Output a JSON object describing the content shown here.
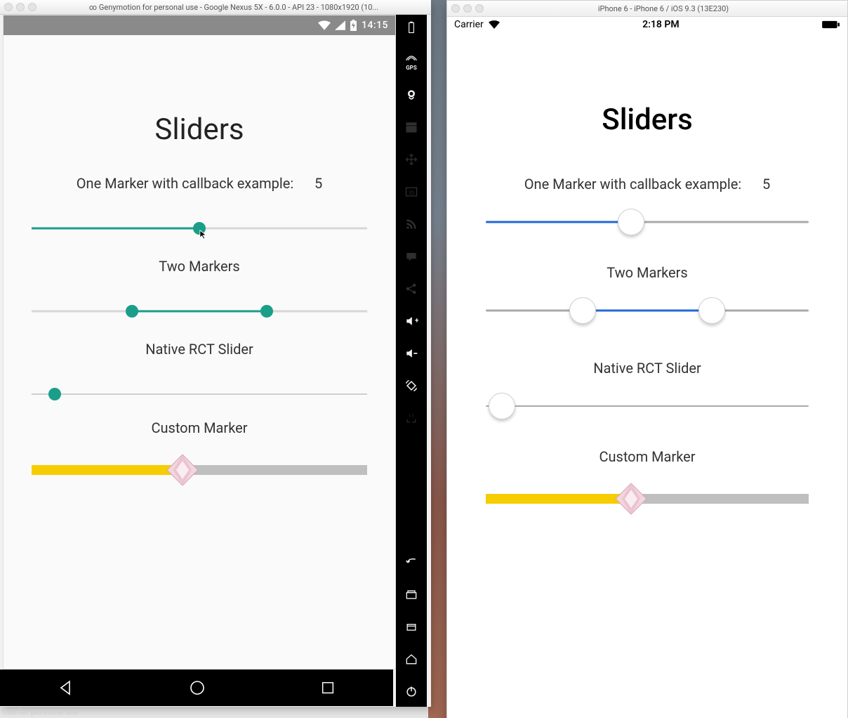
{
  "android": {
    "window_title": "∞  Genymotion for personal use - Google Nexus 5X - 6.0.0 - API 23 - 1080x1920 (10...",
    "status_time": "14:15",
    "title": "Sliders",
    "slider1_label": "One Marker with callback example:",
    "slider1_value": "5",
    "slider1_pos_pct": 50,
    "slider2_label": "Two Markers",
    "slider2_left_pct": 30,
    "slider2_right_pct": 70,
    "slider3_label": "Native RCT Slider",
    "slider3_pos_pct": 7,
    "slider4_label": "Custom Marker",
    "slider4_pos_pct": 45,
    "toolbar": [
      "battery",
      "gps",
      "camera",
      "clapper",
      "move",
      "id",
      "rss",
      "chat",
      "share",
      "vol-up",
      "vol-down",
      "rotate",
      "fullscreen",
      "back",
      "recent",
      "square-small",
      "power"
    ]
  },
  "ios": {
    "window_title": "iPhone 6 - iPhone 6 / iOS 9.3 (13E230)",
    "carrier": "Carrier",
    "status_time": "2:18 PM",
    "title": "Sliders",
    "slider1_label": "One Marker with callback example:",
    "slider1_value": "5",
    "slider1_pos_pct": 45,
    "slider2_label": "Two Markers",
    "slider2_left_pct": 30,
    "slider2_right_pct": 70,
    "slider3_label": "Native RCT Slider",
    "slider3_pos_pct": 5,
    "slider4_label": "Custom Marker",
    "slider4_pos_pct": 45
  },
  "watermark": "free for personal use",
  "colors": {
    "teal": "#1a9e89",
    "ios_blue": "#2367d8",
    "yellow": "#f6cd00"
  }
}
